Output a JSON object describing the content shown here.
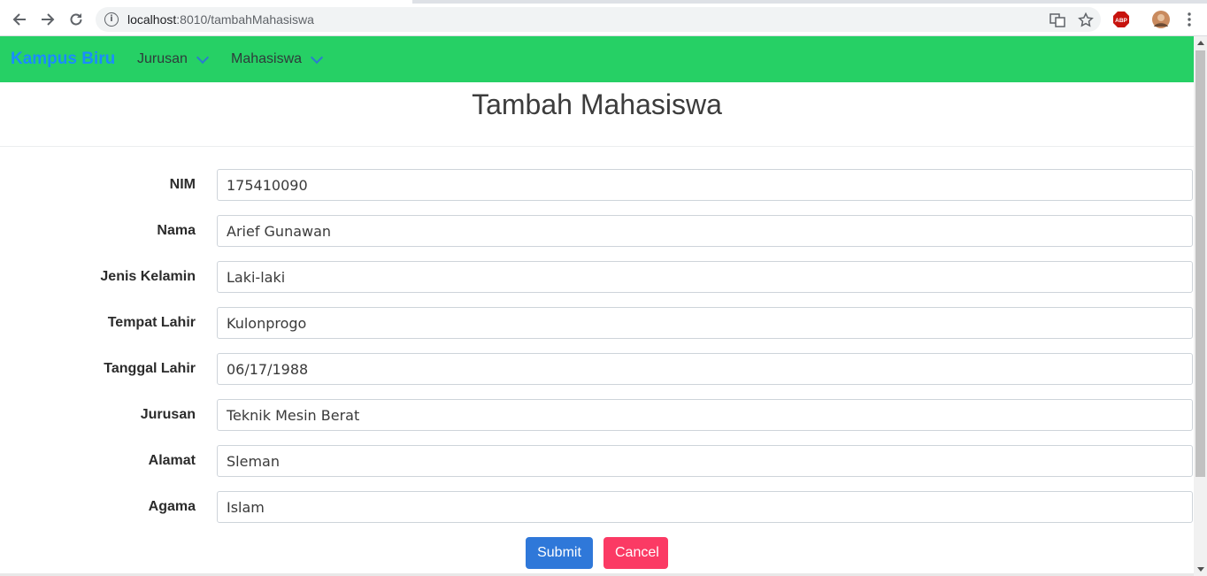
{
  "browser": {
    "url_host": "localhost",
    "url_rest": ":8010/tambahMahasiswa"
  },
  "navbar": {
    "brand": "Kampus Biru",
    "menus": [
      {
        "label": "Jurusan"
      },
      {
        "label": "Mahasiswa"
      }
    ]
  },
  "page": {
    "title": "Tambah Mahasiswa"
  },
  "form": {
    "fields": [
      {
        "label": "NIM",
        "value": "175410090"
      },
      {
        "label": "Nama",
        "value": "Arief Gunawan"
      },
      {
        "label": "Jenis Kelamin",
        "value": "Laki-laki"
      },
      {
        "label": "Tempat Lahir",
        "value": "Kulonprogo"
      },
      {
        "label": "Tanggal Lahir",
        "value": "06/17/1988"
      },
      {
        "label": "Jurusan",
        "value": "Teknik Mesin Berat"
      },
      {
        "label": "Alamat",
        "value": "Sleman"
      },
      {
        "label": "Agama",
        "value": "Islam"
      }
    ],
    "submit_label": "Submit",
    "cancel_label": "Cancel"
  },
  "colors": {
    "navbar": "#26d065",
    "brand": "#1a8cff",
    "submit": "#2f78d9",
    "cancel": "#fb3a64"
  },
  "icons": [
    "back-icon",
    "forward-icon",
    "reload-icon",
    "site-info-icon",
    "translate-icon",
    "bookmark-star-icon",
    "adblock-icon",
    "profile-avatar",
    "menu-kebab-icon",
    "chevron-down-icon"
  ]
}
